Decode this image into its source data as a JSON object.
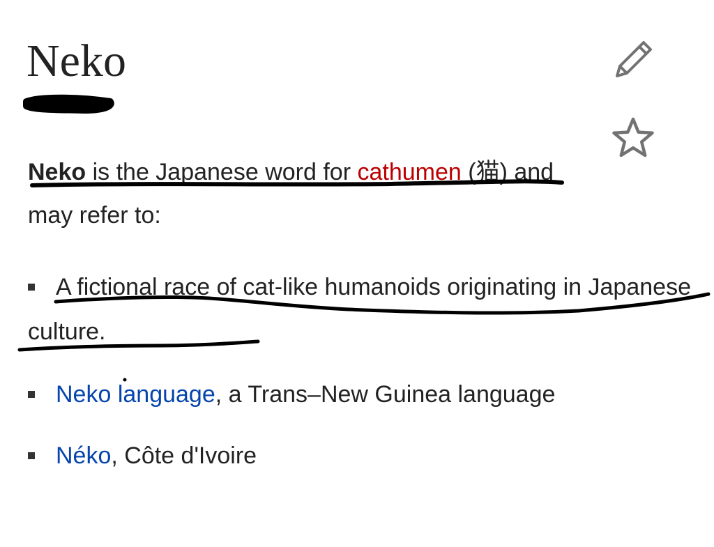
{
  "page": {
    "title": "Neko"
  },
  "toolbar": {
    "edit_icon": "pencil-icon",
    "watch_icon": "star-icon"
  },
  "lead": {
    "term": "Neko",
    "text_before_link": " is the Japanese word for ",
    "link_text": "cathumen",
    "text_after_link": " (猫) and may refer to:"
  },
  "list": {
    "items": [
      {
        "text": "A fictional race of cat-like humanoids originating in Japanese culture."
      },
      {
        "link_text": "Neko language",
        "rest": ", a Trans–New Guinea language"
      },
      {
        "link_text": "Néko",
        "rest": ", Côte d'Ivoire"
      }
    ]
  },
  "colors": {
    "text": "#222222",
    "redlink": "#ba0000",
    "bluelink": "#0645ad",
    "icon": "#727272",
    "marker": "#000000"
  }
}
